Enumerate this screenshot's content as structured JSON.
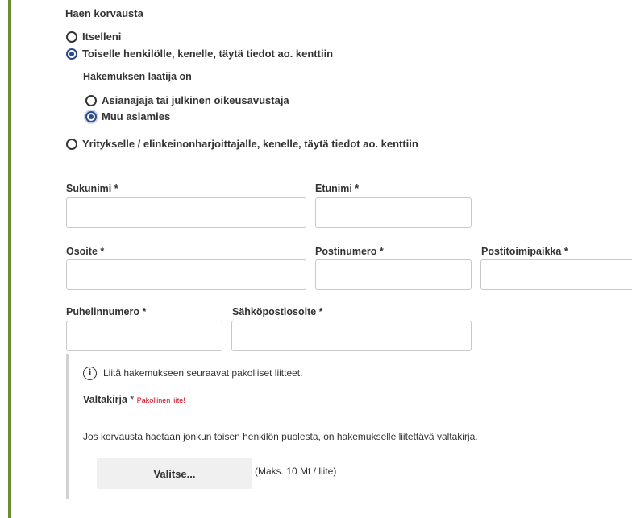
{
  "section_title": "Haen korvausta",
  "options": {
    "self": "Itselleni",
    "other": "Toiselle henkilölle, kenelle, täytä tiedot ao. kenttiin",
    "company": "Yritykselle / elinkeinonharjoittajalle, kenelle, täytä tiedot ao. kenttiin"
  },
  "applicant": {
    "title": "Hakemuksen laatija on",
    "lawyer": "Asianajaja tai julkinen oikeusavustaja",
    "other_agent": "Muu asiamies"
  },
  "fields": {
    "surname": "Sukunimi *",
    "firstname": "Etunimi *",
    "address": "Osoite *",
    "postal_code": "Postinumero *",
    "postal_city": "Postitoimipaikka *",
    "phone": "Puhelinnumero *",
    "email": "Sähköpostiosoite *"
  },
  "attachments": {
    "notice": "Liitä hakemukseen seuraavat pakolliset liitteet.",
    "title": "Valtakirja",
    "title_star": "*",
    "required_text": "Pakollinen liite!",
    "description": "Jos korvausta haetaan jonkun toisen henkilön puolesta, on hakemukselle liitettävä valtakirja.",
    "button": "Valitse...",
    "limit": "(Maks. 10 Mt / liite)"
  },
  "selected": {
    "recipient": "other",
    "applicant": "other_agent"
  }
}
